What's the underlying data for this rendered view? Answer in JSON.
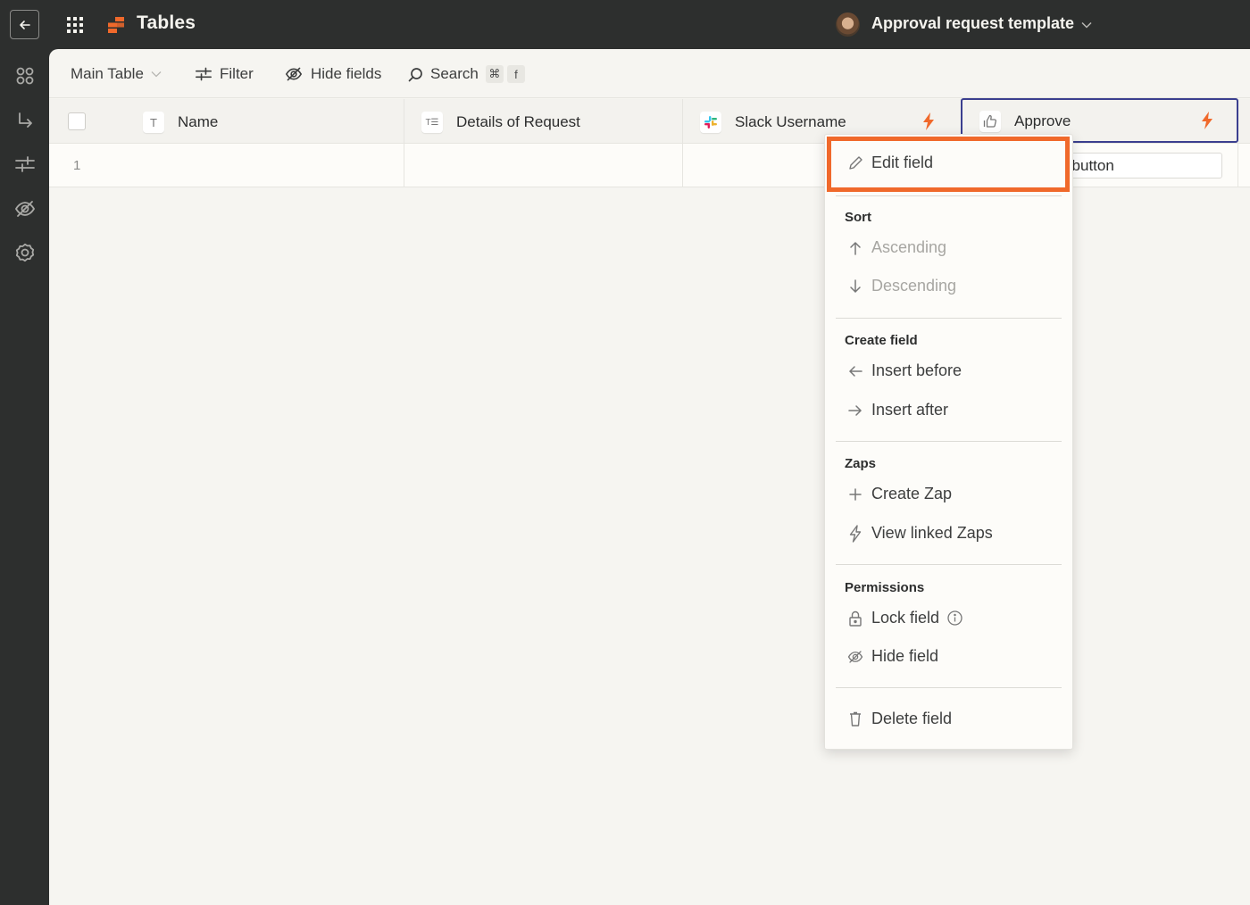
{
  "topbar": {
    "app_title": "Tables",
    "project_title": "Approval request template",
    "brand_color": "#f0692b"
  },
  "rail": {
    "items": [
      {
        "icon": "fields-icon"
      },
      {
        "icon": "arrow-turn-icon"
      },
      {
        "icon": "filter-icon"
      },
      {
        "icon": "hide-icon"
      },
      {
        "icon": "gear-icon"
      }
    ]
  },
  "toolbar": {
    "view_name": "Main Table",
    "filter_label": "Filter",
    "hide_fields_label": "Hide fields",
    "search_label": "Search",
    "search_shortcut_key1": "⌘",
    "search_shortcut_key2": "f"
  },
  "table": {
    "columns": [
      {
        "label": "Name",
        "type_icon": "T"
      },
      {
        "label": "Details of Request",
        "type_icon": "T☰"
      },
      {
        "label": "Slack Username",
        "type_icon": "slack"
      },
      {
        "label": "Approve",
        "type_icon": "thumbs-up"
      }
    ],
    "rows": [
      {
        "number": "1",
        "approve_button": "Set up button"
      }
    ],
    "approve_button_visible": "et up button"
  },
  "menu": {
    "edit_field": "Edit field",
    "sort_heading": "Sort",
    "ascending": "Ascending",
    "descending": "Descending",
    "create_heading": "Create field",
    "insert_before": "Insert before",
    "insert_after": "Insert after",
    "zaps_heading": "Zaps",
    "create_zap": "Create Zap",
    "view_linked_zaps": "View linked Zaps",
    "permissions_heading": "Permissions",
    "lock_field": "Lock field",
    "hide_field": "Hide field",
    "delete_field": "Delete field",
    "highlight_color": "#f0692b"
  }
}
